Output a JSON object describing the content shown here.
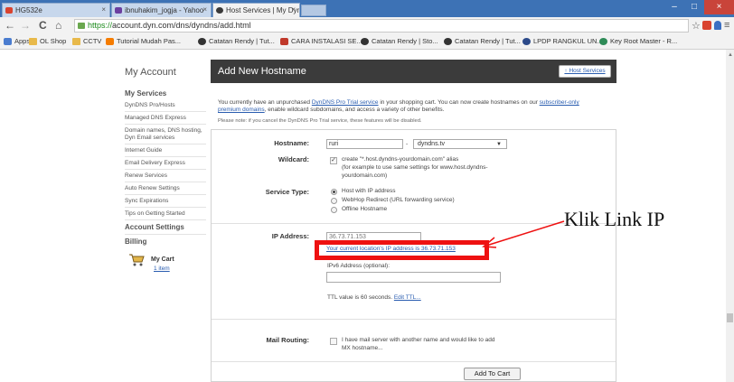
{
  "browser": {
    "tabs": [
      {
        "title": "HG532e",
        "icon_color": "#d9432f"
      },
      {
        "title": "ibnuhakim_jogja - Yahoo",
        "icon_color": "#6b3fa0"
      },
      {
        "title": "Host Services | My Dyn Ac",
        "icon_color": "#3a3a3a"
      }
    ],
    "tab_close": "×",
    "window_controls": {
      "minimize": "–",
      "maximize": "□",
      "close": "×"
    },
    "nav": {
      "back": "←",
      "forward": "→",
      "reload": "C",
      "home": "⌂"
    },
    "url_scheme": "https://",
    "url_rest": "account.dyn.com/dns/dyndns/add.html",
    "toolbar_icons": {
      "star": "☆",
      "menu": "≡"
    },
    "bookmarks": [
      {
        "label": "Apps",
        "icon": "apps-grid"
      },
      {
        "label": "OL Shop",
        "icon": "folder"
      },
      {
        "label": "CCTV",
        "icon": "folder"
      },
      {
        "label": "Tutorial Mudah Pas...",
        "icon": "blogger"
      },
      {
        "label": "Catatan Rendy | Tut...",
        "icon": "page"
      },
      {
        "label": "CARA INSTALASI SE...",
        "icon": "site"
      },
      {
        "label": "Catatan Rendy | Sto...",
        "icon": "page"
      },
      {
        "label": "Catatan Rendy | Tut...",
        "icon": "page"
      },
      {
        "label": "LPDP RANGKUL UN...",
        "icon": "site"
      },
      {
        "label": "Key Root Master - R...",
        "icon": "site"
      }
    ]
  },
  "sidebar": {
    "title": "My Account",
    "services_heading": "My Services",
    "items": [
      "DynDNS Pro/Hosts",
      "Managed DNS Express",
      "Domain names, DNS hosting,",
      "Dyn Email services",
      "Internet Guide",
      "Email Delivery Express",
      "Renew Services",
      "Auto Renew Settings",
      "Sync Expirations",
      "Tips on Getting Started"
    ],
    "account_settings": "Account Settings",
    "billing": "Billing",
    "cart_label": "My Cart",
    "cart_count": "1 item"
  },
  "page": {
    "title": "Add New Hostname",
    "host_services_btn": "↑ Host Services",
    "intro_1": "You currently have an unpurchased ",
    "intro_link_1": "DynDNS Pro Trial service",
    "intro_2": " in your shopping cart. You can now create hostnames on our ",
    "intro_link_2": "subscriber-only",
    "intro_link_3": "premium domains",
    "intro_3": ", enable wildcard subdomains, and access a variety of other benefits.",
    "note": "Please note: if you cancel the DynDNS Pro Trial service, these features will be disabled."
  },
  "form": {
    "hostname_label": "Hostname:",
    "hostname_value": "ruri",
    "hostname_sep": "-",
    "domain_value": "dyndns.tv",
    "wildcard_label": "Wildcard:",
    "wildcard_text_1": "create \"*.host.dyndns-yourdomain.com\" alias",
    "wildcard_text_2": "(for example to use same settings for www.host.dyndns-",
    "wildcard_text_3": "yourdomain.com)",
    "service_type_label": "Service Type:",
    "service_options": [
      "Host with IP address",
      "WebHop Redirect (URL forwarding service)",
      "Offline Hostname"
    ],
    "ip_label": "IP Address:",
    "ip_value": "36.73.71.153",
    "ip_link": "Your current location's IP address is 36.73.71.153",
    "ipv6_label": "IPv6 Address (optional):",
    "ttl_text": "TTL value is 60 seconds.",
    "ttl_link": "Edit TTL...",
    "mail_label": "Mail Routing:",
    "mail_text_1": "I have mail server with another name and would like to add",
    "mail_text_2": "MX hostname...",
    "add_to_cart": "Add To Cart"
  },
  "annotation": {
    "text": "Klik Link IP",
    "color": "#ee1111"
  }
}
